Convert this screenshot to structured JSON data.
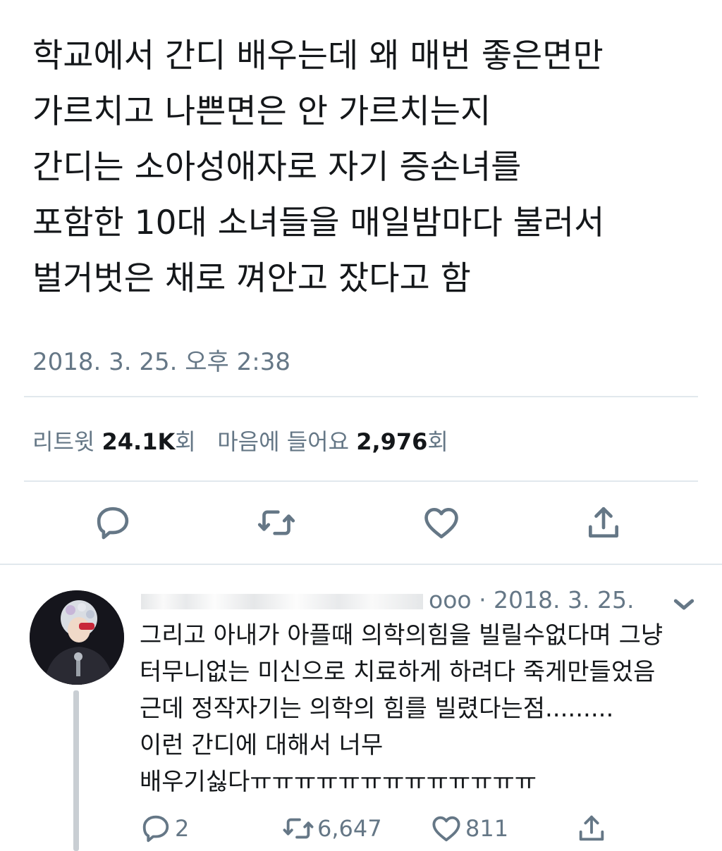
{
  "tweet": {
    "lines": [
      "학교에서 간디 배우는데 왜 매번 좋은면만",
      "가르치고 나쁜면은 안 가르치는지",
      "간디는 소아성애자로 자기 증손녀를",
      "포함한 10대 소녀들을 매일밤마다 불러서",
      "벌거벗은 채로 껴안고 잤다고 함"
    ],
    "timestamp": "2018. 3. 25. 오후 2:38",
    "stats": {
      "retweet_label": "리트윗",
      "retweet_count": "24.1K",
      "retweet_suffix": "회",
      "like_label": "마음에 들어요",
      "like_count": "2,976",
      "like_suffix": "회"
    },
    "actions": {
      "reply_icon": "reply-bubble-icon",
      "retweet_icon": "retweet-icon",
      "like_icon": "heart-icon",
      "share_icon": "share-icon"
    }
  },
  "reply": {
    "handle_visible": "ooo",
    "date": "· 2018. 3. 25.",
    "lines": [
      "그리고 아내가 아플때 의학의힘을 빌릴수없다며 그냥",
      "터무니없는 미신으로 치료하게 하려다 죽게만들었음",
      "근데 정작자기는 의학의 힘를 빌렸다는점.........",
      "이런 간디에 대해서 너무",
      "배우기싫다ㅠㅠㅠㅠㅠㅠㅠㅠㅠㅠㅠㅠㅠ"
    ],
    "reply_count": "2",
    "retweet_count": "6,647",
    "like_count": "811"
  },
  "colors": {
    "text": "#14171a",
    "secondary": "#657786",
    "divider": "#e1e8ed"
  }
}
